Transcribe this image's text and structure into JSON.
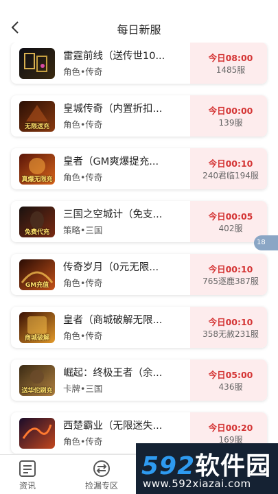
{
  "header": {
    "title": "每日新服",
    "back_icon": "chevron-left-icon"
  },
  "games": [
    {
      "name": "雷霆前线（送传世10...",
      "category": "角色•传奇",
      "time": "今日08:00",
      "server": "1485服",
      "thumb_text": "",
      "colors": [
        "#0d0d14",
        "#3a2a10"
      ]
    },
    {
      "name": "皇城传奇（内置折扣...",
      "category": "角色•传奇",
      "time": "今日00:00",
      "server": "139服",
      "thumb_text": "无限送充",
      "colors": [
        "#2a0f05",
        "#8a3a10"
      ]
    },
    {
      "name": "皇者（GM爽爆提充...",
      "category": "角色•传奇",
      "time": "今日00:10",
      "server": "240君临194服",
      "thumb_text": "真爆无限充",
      "colors": [
        "#5a1508",
        "#d8661c"
      ]
    },
    {
      "name": "三国之空城计（免支...",
      "category": "策略•三国",
      "time": "今日00:05",
      "server": "402服",
      "thumb_text": "免费代充",
      "colors": [
        "#1a1210",
        "#7a2a12"
      ]
    },
    {
      "name": "传奇岁月（0元无限...",
      "category": "角色•传奇",
      "time": "今日00:10",
      "server": "765逐鹿387服",
      "thumb_text": "GM充值",
      "colors": [
        "#2a0c04",
        "#c4521a"
      ]
    },
    {
      "name": "皇者（商城破解无限...",
      "category": "角色•传奇",
      "time": "今日00:10",
      "server": "358无赦231服",
      "thumb_text": "商城破解",
      "colors": [
        "#3a1004",
        "#e39a2a"
      ]
    },
    {
      "name": "崛起：终极王者（余...",
      "category": "卡牌•三国",
      "time": "今日05:00",
      "server": "436服",
      "thumb_text": "送华佗刷充",
      "colors": [
        "#3a2a14",
        "#b08040"
      ]
    },
    {
      "name": "西楚霸业（无限迷失...",
      "category": "角色•传奇",
      "time": "今日00:20",
      "server": "169服",
      "thumb_text": "",
      "colors": [
        "#1a0c2a",
        "#c2471e"
      ]
    }
  ],
  "float_badge": "18",
  "tabbar": [
    {
      "label": "资讯",
      "icon": "news-icon"
    },
    {
      "label": "捡漏专区",
      "icon": "exchange-icon"
    }
  ],
  "watermark": {
    "brand_num": "592",
    "brand_text": "软件园",
    "url": "www.592xiazai.com"
  },
  "theme": {
    "accent": "#d43434",
    "card_right_bg": "#fdeced"
  }
}
